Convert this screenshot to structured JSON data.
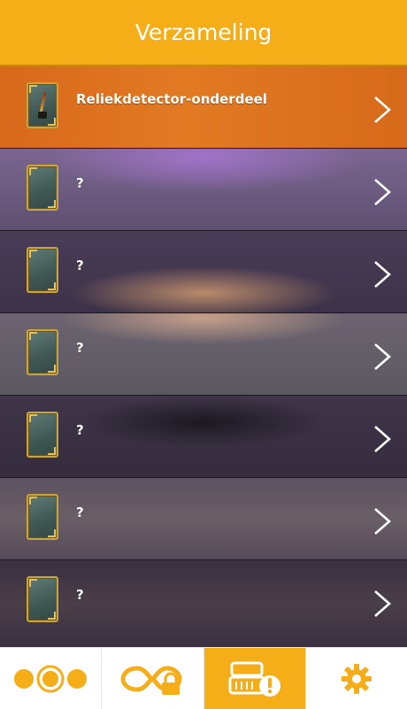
{
  "header": {
    "title": "Verzameling"
  },
  "collection": {
    "items": [
      {
        "label": "Reliekdetector-onderdeel",
        "revealed": true
      },
      {
        "label": "?",
        "revealed": false
      },
      {
        "label": "?",
        "revealed": false
      },
      {
        "label": "?",
        "revealed": false
      },
      {
        "label": "?",
        "revealed": false
      },
      {
        "label": "?",
        "revealed": false
      },
      {
        "label": "?",
        "revealed": false
      }
    ]
  },
  "tabbar": {
    "tabs": [
      {
        "icon": "three-circles-icon",
        "active": false
      },
      {
        "icon": "infinity-locked-icon",
        "active": false
      },
      {
        "icon": "collection-alert-icon",
        "active": true
      },
      {
        "icon": "gear-icon",
        "active": false
      }
    ]
  },
  "colors": {
    "accent": "#f5ad18",
    "first_row": "#e0701c",
    "text": "#ffffff"
  }
}
